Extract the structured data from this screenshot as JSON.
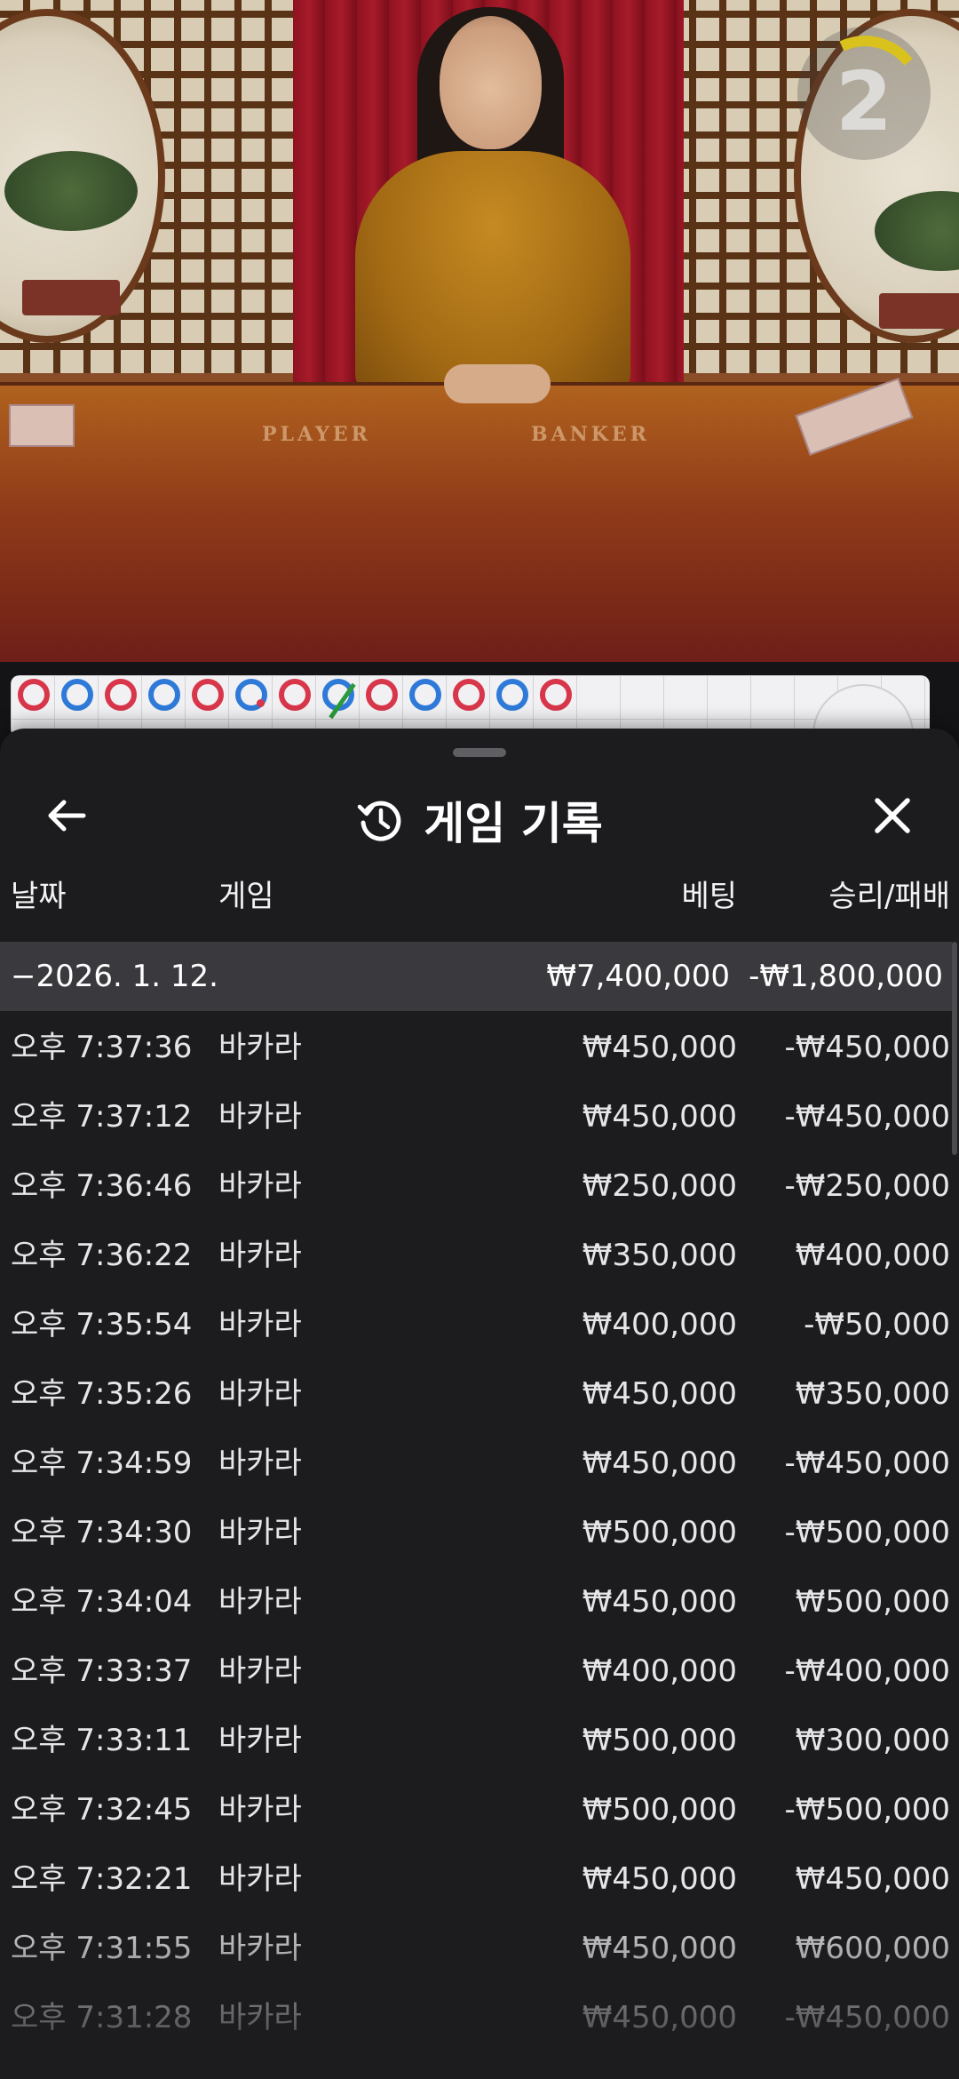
{
  "video": {
    "table_labels": [
      "PLAYER",
      "BANKER"
    ],
    "timer": "2"
  },
  "road": {
    "beads": [
      "banker",
      "player",
      "banker",
      "player",
      "banker",
      "player",
      "banker",
      "player",
      "banker",
      "player",
      "banker",
      "player",
      "banker"
    ]
  },
  "sheet": {
    "title": "게임 기록",
    "columns": {
      "date": "날짜",
      "game": "게임",
      "bet": "베팅",
      "result": "승리/패배"
    },
    "summary": {
      "date": "−2026. 1. 12.",
      "bet": "₩7,400,000",
      "result": "-₩1,800,000"
    },
    "rows": [
      {
        "time": "오후 7:37:36",
        "game": "바카라",
        "bet": "₩450,000",
        "result": "-₩450,000"
      },
      {
        "time": "오후 7:37:12",
        "game": "바카라",
        "bet": "₩450,000",
        "result": "-₩450,000"
      },
      {
        "time": "오후 7:36:46",
        "game": "바카라",
        "bet": "₩250,000",
        "result": "-₩250,000"
      },
      {
        "time": "오후 7:36:22",
        "game": "바카라",
        "bet": "₩350,000",
        "result": "₩400,000"
      },
      {
        "time": "오후 7:35:54",
        "game": "바카라",
        "bet": "₩400,000",
        "result": "-₩50,000"
      },
      {
        "time": "오후 7:35:26",
        "game": "바카라",
        "bet": "₩450,000",
        "result": "₩350,000"
      },
      {
        "time": "오후 7:34:59",
        "game": "바카라",
        "bet": "₩450,000",
        "result": "-₩450,000"
      },
      {
        "time": "오후 7:34:30",
        "game": "바카라",
        "bet": "₩500,000",
        "result": "-₩500,000"
      },
      {
        "time": "오후 7:34:04",
        "game": "바카라",
        "bet": "₩450,000",
        "result": "₩500,000"
      },
      {
        "time": "오후 7:33:37",
        "game": "바카라",
        "bet": "₩400,000",
        "result": "-₩400,000"
      },
      {
        "time": "오후 7:33:11",
        "game": "바카라",
        "bet": "₩500,000",
        "result": "₩300,000"
      },
      {
        "time": "오후 7:32:45",
        "game": "바카라",
        "bet": "₩500,000",
        "result": "-₩500,000"
      },
      {
        "time": "오후 7:32:21",
        "game": "바카라",
        "bet": "₩450,000",
        "result": "₩450,000"
      },
      {
        "time": "오후 7:31:55",
        "game": "바카라",
        "bet": "₩450,000",
        "result": "₩600,000"
      },
      {
        "time": "오후 7:31:28",
        "game": "바카라",
        "bet": "₩450,000",
        "result": "-₩450,000"
      }
    ]
  },
  "colors": {
    "sheet_bg": "#1c1b1e",
    "summary_bg": "#3a393d",
    "banker": "#d8364a",
    "player": "#2f7ad8",
    "tie": "#2a9a3a"
  },
  "icons": {
    "back": "arrow-left-icon",
    "history": "history-icon",
    "close": "close-icon"
  }
}
